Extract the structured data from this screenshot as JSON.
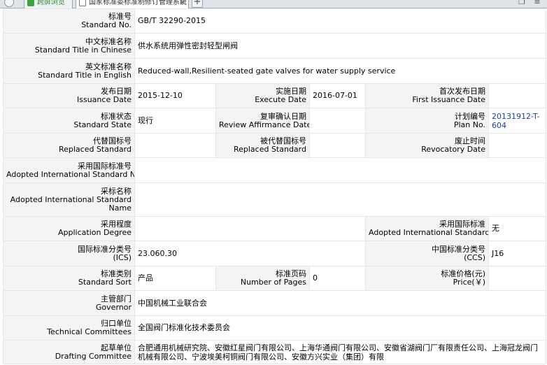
{
  "browser": {
    "tabs": [
      {
        "label": "跨屏浏览"
      },
      {
        "label": "国家标准委标准制修订管理系统"
      }
    ],
    "new_tab_label": "+",
    "close_label": "×"
  },
  "fields": {
    "standard_no": {
      "cn": "标准号",
      "en": "Standard No.",
      "value": "GB/T 32290-2015"
    },
    "title_cn": {
      "cn": "中文标准名称",
      "en": "Standard Title in Chinese",
      "value": "供水系统用弹性密封轻型闸阀"
    },
    "title_en": {
      "cn": "英文标准名称",
      "en": "Standard Title in English",
      "value": "Reduced-wall,Resilient-seated gate valves for water supply service"
    },
    "issuance_date": {
      "cn": "发布日期",
      "en": "Issuance Date",
      "value": "2015-12-10"
    },
    "execute_date": {
      "cn": "实施日期",
      "en": "Execute Date",
      "value": "2016-07-01"
    },
    "first_issuance_date": {
      "cn": "首次发布日期",
      "en": "First Issuance Date",
      "value": ""
    },
    "standard_state": {
      "cn": "标准状态",
      "en": "Standard State",
      "value": "现行"
    },
    "review_date": {
      "cn": "复审确认日期",
      "en": "Review Affirmance Date",
      "value": ""
    },
    "plan_no": {
      "cn": "计划编号",
      "en": "Plan No.",
      "value": "20131912-T-604"
    },
    "replaced_standard": {
      "cn": "代替国标号",
      "en": "Replaced Standard",
      "value": ""
    },
    "replaced_by_standard": {
      "cn": "被代替国标号",
      "en": "Replaced Standard",
      "value": ""
    },
    "revocatory_date": {
      "cn": "废止时间",
      "en": "Revocatory Date",
      "value": ""
    },
    "adopted_intl_no": {
      "cn": "采用国际标准号",
      "en": "Adopted International Standard No.",
      "value": ""
    },
    "adopted_intl_name": {
      "cn": "采标名称",
      "en": "Adopted International Standard Name",
      "value": ""
    },
    "application_degree": {
      "cn": "采用程度",
      "en": "Application Degree",
      "value": ""
    },
    "adopted_intl_standard": {
      "cn": "采用国际标准",
      "en": "Adopted International Standard",
      "value": "无"
    },
    "ics": {
      "cn": "国际标准分类号",
      "en": "(ICS)",
      "value": "23.060.30"
    },
    "ccs": {
      "cn": "中国标准分类号",
      "en": "(CCS)",
      "value": "J16"
    },
    "standard_sort": {
      "cn": "标准类别",
      "en": "Standard Sort",
      "value": "产品"
    },
    "number_of_pages": {
      "cn": "标准页码",
      "en": "Number of Pages",
      "value": "0"
    },
    "price": {
      "cn": "标准价格(元)",
      "en": "Price(￥)",
      "value": ""
    },
    "governor": {
      "cn": "主管部门",
      "en": "Governor",
      "value": "中国机械工业联合会"
    },
    "technical_committees": {
      "cn": "归口单位",
      "en": "Technical Committees",
      "value": "全国阀门标准化技术委员会"
    },
    "drafting_committee": {
      "cn": "起草单位",
      "en": "Drafting Committee",
      "value": "合肥通用机械研究院、安徽红星阀门有限公司、上海华通阀门有限公司、安徽省湖阀门厂有限责任公司、上海冠龙阀门机械有限公司、宁波埃美柯铜阀门有限公司、安徽方兴实业（集团）有限"
    }
  }
}
